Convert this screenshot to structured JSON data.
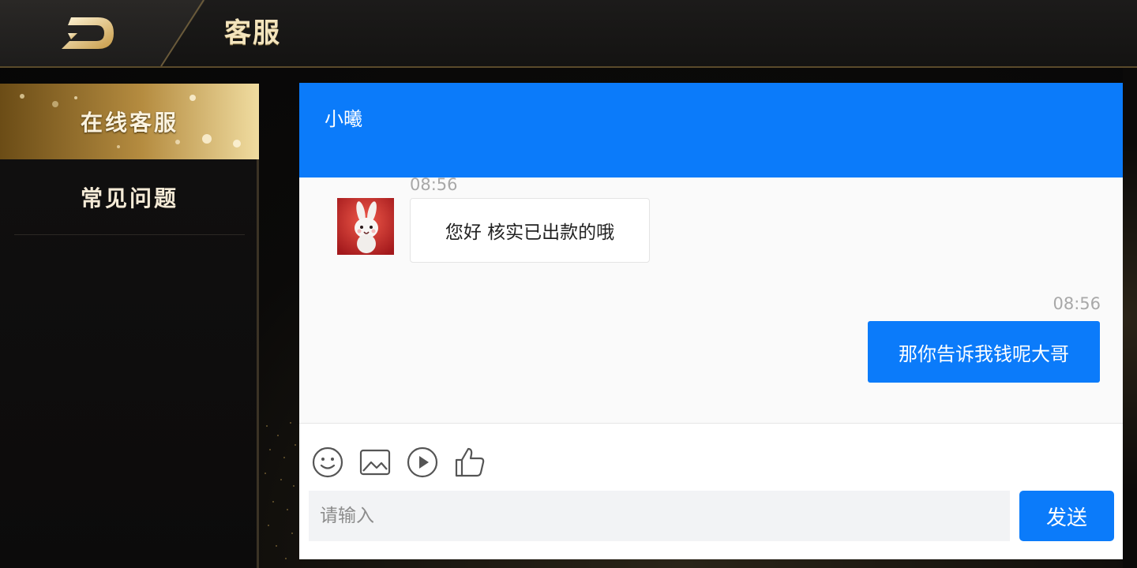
{
  "header": {
    "title": "客服"
  },
  "sidebar": {
    "items": [
      {
        "label": "在线客服",
        "active": true
      },
      {
        "label": "常见问题",
        "active": false
      }
    ]
  },
  "chat": {
    "agent_name": "小曦",
    "messages": [
      {
        "side": "left",
        "time": "08:56",
        "text": "您好 核实已出款的哦"
      },
      {
        "side": "right",
        "time": "08:56",
        "text": "那你告诉我钱呢大哥"
      }
    ],
    "toolbar": {
      "icons": [
        "emoji-icon",
        "image-icon",
        "video-icon",
        "thumbs-up-icon"
      ]
    },
    "input": {
      "placeholder": "请输入",
      "value": ""
    },
    "send_label": "发送"
  },
  "colors": {
    "accent": "#0b7bfa",
    "gold": "#c9a45a"
  }
}
